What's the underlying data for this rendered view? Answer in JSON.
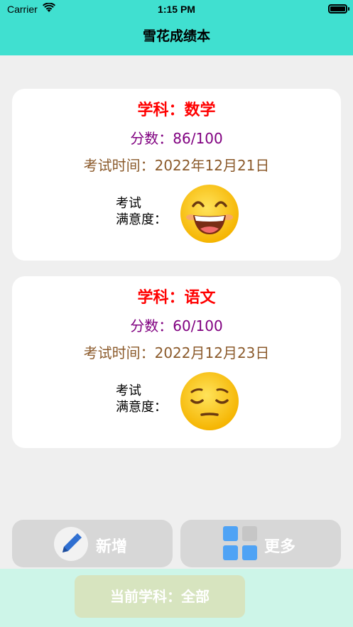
{
  "status_bar": {
    "carrier": "Carrier",
    "time": "1:15 PM"
  },
  "nav": {
    "title": "雪花成绩本"
  },
  "cards": [
    {
      "subject": "学科：数学",
      "score": "分数：86/100",
      "date": "考试时间：2022年12月21日",
      "satisfaction_label_line1": "考试",
      "satisfaction_label_line2": "满意度：",
      "face_icon": "grinning-face-icon"
    },
    {
      "subject": "学科：语文",
      "score": "分数：60/100",
      "date": "考试时间：2022月12月23日",
      "satisfaction_label_line1": "考试",
      "satisfaction_label_line2": "满意度：",
      "face_icon": "pensive-face-icon"
    }
  ],
  "actions": {
    "add_label": "新增",
    "more_label": "更多"
  },
  "footer": {
    "filter_label": "当前学科：全部"
  },
  "colors": {
    "header": "#40e0d0",
    "subject": "#ff0000",
    "score": "#800080",
    "date": "#8b5a2b",
    "footer": "#cdf5e8"
  }
}
